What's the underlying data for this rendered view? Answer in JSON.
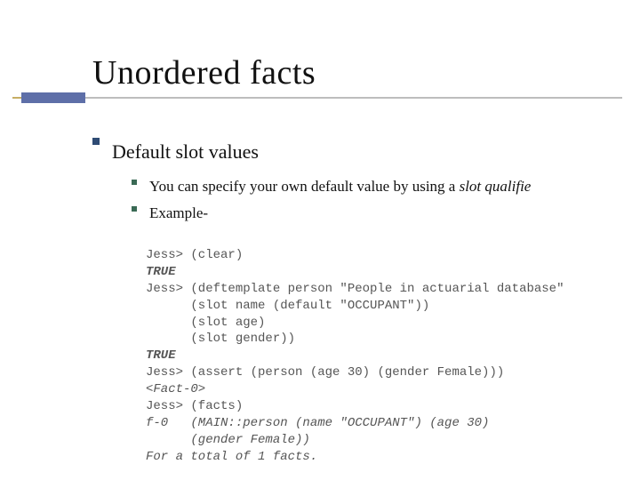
{
  "title": "Unordered facts",
  "lvl1": "Default slot values",
  "lvl2a_pre": "You can specify your own default value by using a ",
  "lvl2a_em": "slot qualifie",
  "lvl2b": "Example-",
  "code": {
    "l1": "Jess> (clear)",
    "l2": "TRUE",
    "l3": "Jess> (deftemplate person \"People in actuarial database\"",
    "l4": "      (slot name (default \"OCCUPANT\"))",
    "l5": "      (slot age)",
    "l6": "      (slot gender))",
    "l7": "TRUE",
    "l8": "Jess> (assert (person (age 30) (gender Female)))",
    "l9": "<Fact-0>",
    "l10": "Jess> (facts)",
    "l11": "f-0   (MAIN::person (name \"OCCUPANT\") (age 30)",
    "l12": "      (gender Female))",
    "l13": "For a total of 1 facts."
  }
}
